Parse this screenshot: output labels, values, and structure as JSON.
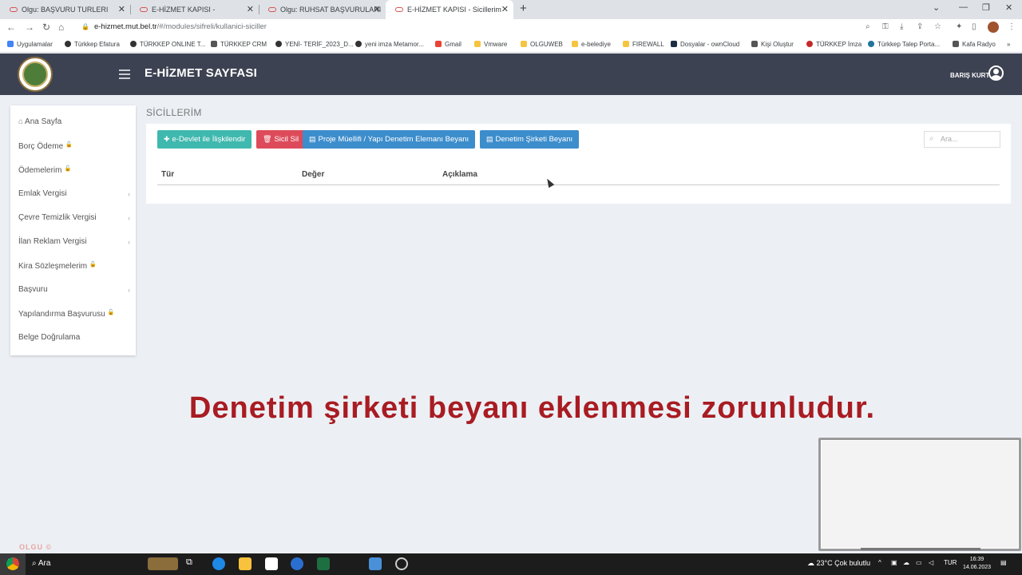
{
  "browser": {
    "tabs": [
      {
        "label": "Olgu: BAŞVURU TURLERI",
        "active": false
      },
      {
        "label": "E-HİZMET KAPISI -",
        "active": false
      },
      {
        "label": "Olgu: RUHSAT BAŞVURULARI",
        "active": false
      },
      {
        "label": "E-HİZMET KAPISI - Sicillerim",
        "active": true
      }
    ],
    "url_host": "e-hizmet.mut.bel.tr",
    "url_path": "/#/modules/sifreli/kullanici-siciller",
    "bookmarks": [
      "Uygulamalar",
      "Türkkep Efatura",
      "TÜRKKEP ONLINE T...",
      "TÜRKKEP CRM",
      "YENİ- TERİF_2023_D...",
      "yeni imza Metamor...",
      "Gmail",
      "Vmware",
      "OLGUWEB",
      "e-belediye",
      "FIREWALL",
      "Dosyalar - ownCloud",
      "Kişi Oluştur",
      "TÜRKKEP İmza",
      "Türkkep Talep Porta...",
      "Kafa Radyo"
    ]
  },
  "header": {
    "title": "E-HİZMET SAYFASI",
    "username": "BARIŞ KURT"
  },
  "sidebar": {
    "items": [
      {
        "label": "Ana Sayfa"
      },
      {
        "label": "Borç Ödeme"
      },
      {
        "label": "Ödemelerim"
      },
      {
        "label": "Emlak Vergisi"
      },
      {
        "label": "Çevre Temizlik Vergisi"
      },
      {
        "label": "İlan Reklam Vergisi"
      },
      {
        "label": "Kira Sözleşmelerim"
      },
      {
        "label": "Başvuru"
      },
      {
        "label": "Yapılandırma Başvurusu"
      },
      {
        "label": "Belge Doğrulama"
      }
    ]
  },
  "main": {
    "page_title": "SİCİLLERİM",
    "buttons": {
      "edevlet": "e-Devlet ile İlişkilendir",
      "delete": "Sicil Sil",
      "proje": "Proje Müellifi / Yapı Denetim Elemanı Beyanı",
      "denetim": "Denetim Şirketi Beyanı"
    },
    "search_placeholder": "Ara...",
    "table_headers": [
      "Tür",
      "Değer",
      "Açıklama"
    ]
  },
  "caption": "Denetim şirketi beyanı eklenmesi zorunludur.",
  "watermark": "OLGU ©",
  "taskbar": {
    "search": "Ara",
    "weather": "23°C  Çok bulutlu",
    "lang": "TUR",
    "time": "16:39",
    "date": "14.06.2023"
  },
  "colors": {
    "header_bg": "#3d4252",
    "btn_teal": "#3fb8ae",
    "btn_red": "#dd4b5a",
    "btn_blue": "#3c8dcc",
    "caption": "#a81c22"
  }
}
